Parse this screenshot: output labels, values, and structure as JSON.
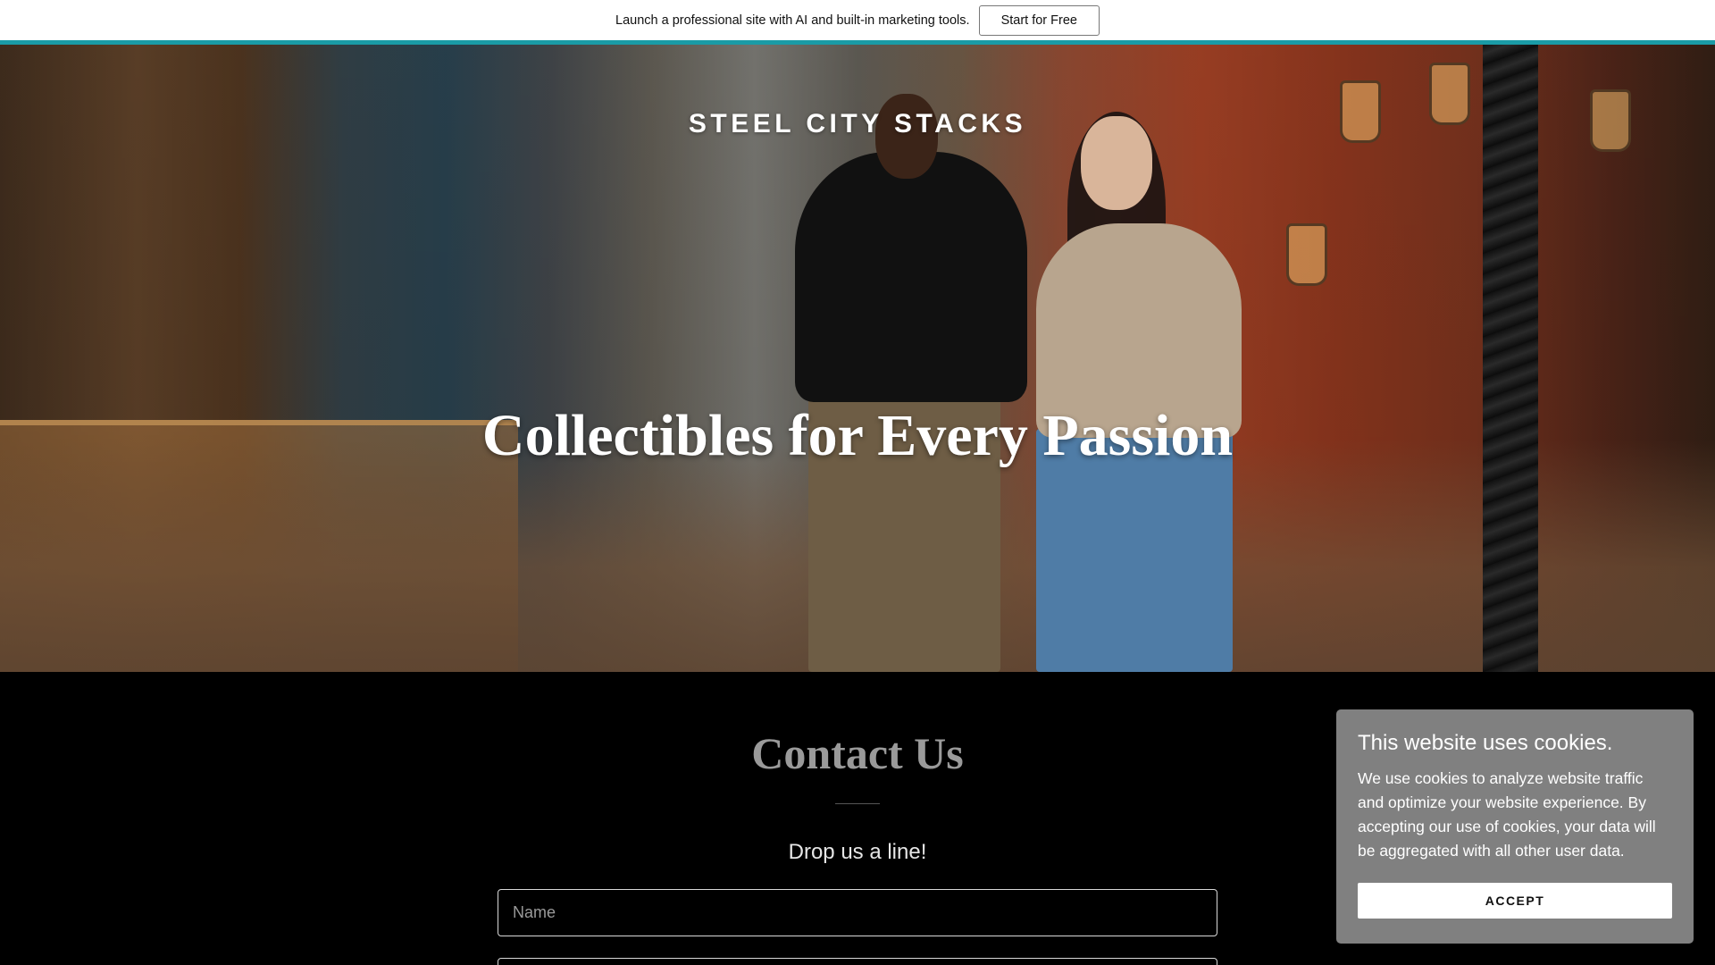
{
  "promo": {
    "text": "Launch a professional site with AI and built-in marketing tools.",
    "button_label": "Start for Free",
    "accent_color": "#1a9ba6"
  },
  "hero": {
    "site_title": "STEEL CITY STACKS",
    "heading": "Collectibles for Every Passion"
  },
  "contact": {
    "title": "Contact Us",
    "subtitle": "Drop us a line!",
    "name_placeholder": "Name",
    "email_placeholder": ""
  },
  "cookie": {
    "title": "This website uses cookies.",
    "text": "We use cookies to analyze website traffic and optimize your website experience. By accepting our use of cookies, your data will be aggregated with all other user data.",
    "accept_label": "ACCEPT"
  },
  "colors": {
    "cookie_bg": "#808080",
    "page_bg": "#000000"
  }
}
